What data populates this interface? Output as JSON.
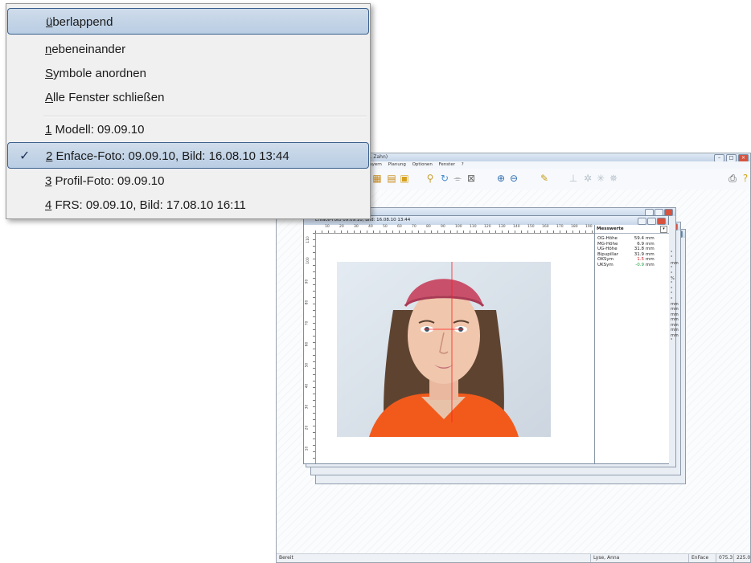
{
  "menu": {
    "items": [
      {
        "accel": "ü",
        "rest": "berlappend",
        "selected": true
      },
      {
        "accel": "n",
        "rest": "ebeneinander",
        "selected": false
      },
      {
        "accel": "S",
        "rest": "ymbole anordnen",
        "selected": false
      },
      {
        "accel": "A",
        "rest": "lle Fenster schließen",
        "selected": false
      }
    ],
    "windows": [
      {
        "accel": "1",
        "rest": " Modell: 09.09.10",
        "checked": false,
        "selected": false
      },
      {
        "accel": "2",
        "rest": " Enface-Foto: 09.09.10,  Bild: 16.08.10  13:44",
        "checked": true,
        "selected": true
      },
      {
        "accel": "3",
        "rest": " Profil-Foto: 09.09.10",
        "checked": false,
        "selected": false
      },
      {
        "accel": "4",
        "rest": " FRS: 09.09.10,  Bild: 17.08.10  16:11",
        "checked": false,
        "selected": false
      }
    ]
  },
  "app": {
    "title": "Dr. Zahn)",
    "menubar": [
      "...ayern",
      "Planung",
      "Optionen",
      "Fenster",
      "?"
    ],
    "status": {
      "left": "Bereit",
      "patient": "Lyse, Anna",
      "mode": "EnFace",
      "coord1": "075.3",
      "coord2": "225.0"
    }
  },
  "front_window": {
    "title": "Enface-Foto 09.09.10, Bild: 16.08.10  13:44",
    "ruler_top": [
      "10",
      "20",
      "30",
      "40",
      "50",
      "60",
      "70",
      "80",
      "90",
      "100",
      "110",
      "120",
      "130",
      "140",
      "150",
      "160",
      "170",
      "180",
      "190"
    ],
    "ruler_left": [
      "110",
      "100",
      "90",
      "80",
      "70",
      "60",
      "50",
      "40",
      "30",
      "20",
      "10"
    ],
    "panel": {
      "header": "Messwerte",
      "rows": [
        {
          "label": "OG-Höhe",
          "value": "59.4",
          "unit": "mm",
          "color": "#222222"
        },
        {
          "label": "MG-Höhe",
          "value": "6.9",
          "unit": "mm",
          "color": "#222222"
        },
        {
          "label": "UG-Höhe",
          "value": "31.8",
          "unit": "mm",
          "color": "#222222"
        },
        {
          "label": "Bipupillar",
          "value": "31.9",
          "unit": "mm",
          "color": "#222222"
        },
        {
          "label": "OKSym",
          "value": "1.5",
          "unit": "mm",
          "color": "#d02020"
        },
        {
          "label": "UKSym",
          "value": "-0.9",
          "unit": "mm",
          "color": "#20a040"
        }
      ]
    }
  },
  "peek_column": [
    "°",
    "°",
    "mm",
    "°",
    "°",
    "%",
    "°",
    "°",
    "°",
    "°",
    "mm",
    "mm",
    "mm",
    "mm",
    "mm",
    "mm",
    "mm",
    "°"
  ]
}
